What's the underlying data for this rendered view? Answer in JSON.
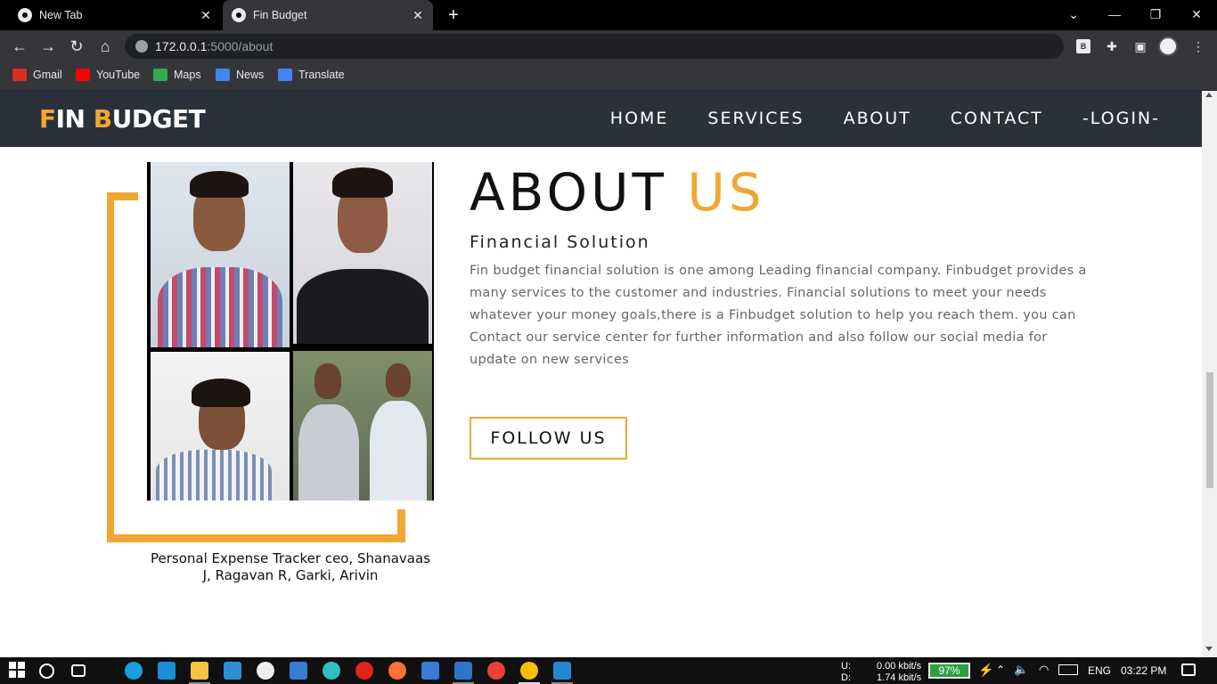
{
  "browser": {
    "tabs": [
      {
        "label": "New Tab"
      },
      {
        "label": "Fin Budget"
      }
    ],
    "address": {
      "host": "172.0.0.1",
      "path": ":5000/about"
    },
    "bookmarks": [
      {
        "label": "Gmail",
        "color": "#d93025"
      },
      {
        "label": "YouTube",
        "color": "#ff0000"
      },
      {
        "label": "Maps",
        "color": "#34a853"
      },
      {
        "label": "News",
        "color": "#4285f4"
      },
      {
        "label": "Translate",
        "color": "#4285f4"
      }
    ],
    "extension_label": "B"
  },
  "site": {
    "brand": {
      "first_letter": "F",
      "first_rest": "IN ",
      "second_letter": "B",
      "second_rest": "UDGET"
    },
    "nav": [
      "HOME",
      "SERVICES",
      "ABOUT",
      "CONTACT",
      "-LOGIN-"
    ],
    "about": {
      "title_main": "ABOUT ",
      "title_accent": "US",
      "subtitle": "Financial Solution",
      "body": "Fin budget financial solution is one among Leading financial company. Finbudget provides a many services to the customer and industries. Financial solutions to meet your needs whatever your money goals,there is a Finbudget solution to help you reach them. you can Contact our service center for further information and also follow our social media for update on new services",
      "button": "FOLLOW US",
      "caption": "Personal Expense Tracker ceo, Shanavaas J, Ragavan R, Garki, Arivin"
    },
    "accent_color": "#f0a733",
    "nav_bg": "#2b313a"
  },
  "taskbar": {
    "net_up_label": "U:",
    "net_down_label": "D:",
    "net_up": "0.00 kbit/s",
    "net_down": "1.74 kbit/s",
    "battery": "97%",
    "lang": "ENG",
    "time": "03:22 PM"
  }
}
